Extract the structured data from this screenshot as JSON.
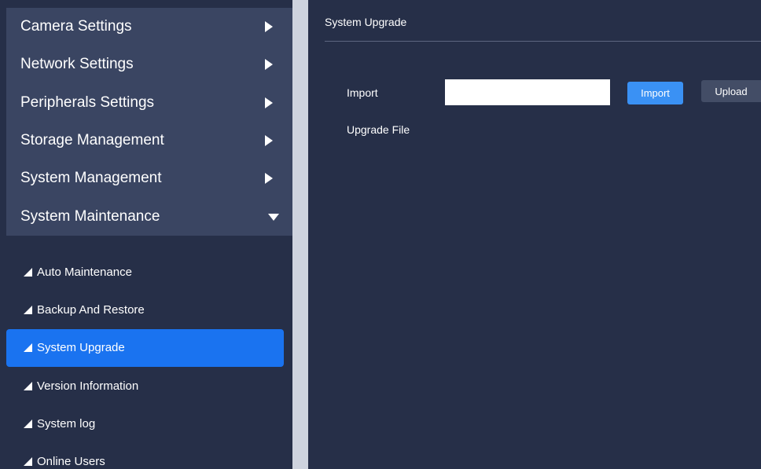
{
  "sidebar": {
    "top_items": [
      {
        "label": "Camera Settings",
        "icon": "caret-right-icon"
      },
      {
        "label": "Network Settings",
        "icon": "caret-right-icon"
      },
      {
        "label": "Peripherals Settings",
        "icon": "caret-right-icon"
      },
      {
        "label": "Storage Management",
        "icon": "caret-right-icon"
      },
      {
        "label": "System Management",
        "icon": "caret-right-icon"
      },
      {
        "label": "System Maintenance",
        "icon": "caret-down-icon"
      }
    ],
    "sub_items": [
      {
        "label": "Auto Maintenance",
        "icon": "triangle-bullet-icon"
      },
      {
        "label": "Backup And Restore",
        "icon": "triangle-bullet-icon"
      },
      {
        "label": "System Upgrade",
        "icon": "triangle-bullet-icon",
        "active": true
      },
      {
        "label": "Version Information",
        "icon": "triangle-bullet-icon"
      },
      {
        "label": "System log",
        "icon": "triangle-bullet-icon"
      },
      {
        "label": "Online Users",
        "icon": "triangle-bullet-icon"
      }
    ]
  },
  "main": {
    "title": "System Upgrade",
    "import_label": "Import",
    "import_value": "",
    "import_button": "Import",
    "upload_button": "Upload",
    "upgrade_file_label": "Upgrade File"
  },
  "colors": {
    "background": "#262f48",
    "menu_group": "#3a4562",
    "active_item": "#1a73f0",
    "import_button": "#3a91f4",
    "upload_button": "#434d66",
    "divider": "#ced3de"
  }
}
